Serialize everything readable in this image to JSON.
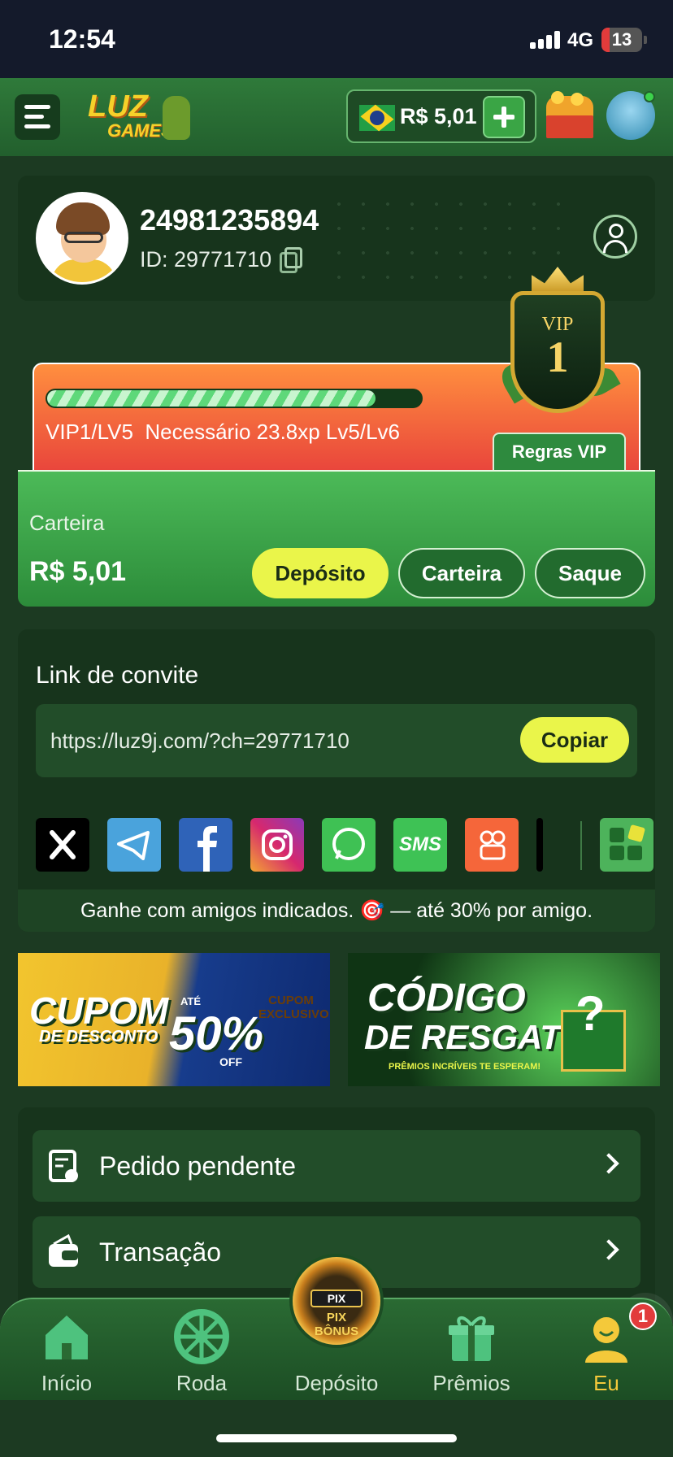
{
  "status_bar": {
    "time": "12:54",
    "network": "4G",
    "battery": "13"
  },
  "header": {
    "menu_icon": "menu-icon",
    "logo_top": "LUZ",
    "logo_bottom": "GAMES",
    "balance": "R$ 5,01",
    "flag_icon": "brazil-flag-icon"
  },
  "profile": {
    "username": "24981235894",
    "id_text": "ID: 29771710"
  },
  "vip": {
    "progress": 0.87,
    "level_text": "VIP1/LV5  Necessário 23.8xp Lv5/Lv6",
    "badge_label": "VIP",
    "badge_level": "1",
    "rules_label": "Regras VIP"
  },
  "wallet": {
    "label": "Carteira",
    "amount": "R$ 5,01",
    "deposit_label": "Depósito",
    "wallet_label": "Carteira",
    "withdraw_label": "Saque"
  },
  "invite": {
    "title": "Link de convite",
    "url": "https://luz9j.com/?ch=29771710",
    "copy_label": "Copiar",
    "share_icons": [
      "x-icon",
      "telegram-icon",
      "facebook-icon",
      "instagram-icon",
      "whatsapp-icon",
      "sms-icon",
      "kwai-icon",
      "more-apps-icon"
    ],
    "sms_text": "SMS",
    "note": "Ganhe com amigos indicados. 🎯 — até 30% por amigo."
  },
  "banners": {
    "coupon": {
      "line1": "CUPOM",
      "line2": "DE DESCONTO",
      "percent": "50%",
      "off": "OFF",
      "ate": "ATÉ",
      "ticket": "CUPOM EXCLUSIVO"
    },
    "code": {
      "line1": "CÓDIGO",
      "line2": "DE RESGATE",
      "tagline": "PRÊMIOS INCRÍVEIS TE ESPERAM!"
    }
  },
  "menu": {
    "items": [
      {
        "label": "Pedido pendente"
      },
      {
        "label": "Transação"
      }
    ]
  },
  "bottom_nav": {
    "items": [
      {
        "label": "Início"
      },
      {
        "label": "Roda"
      },
      {
        "label": "Depósito"
      },
      {
        "label": "Prêmios"
      },
      {
        "label": "Eu"
      }
    ],
    "fab_pix": "PIX",
    "fab_bonus": "PIX BÔNUS",
    "badge_count": "1",
    "active_color": "#f4c93a"
  }
}
